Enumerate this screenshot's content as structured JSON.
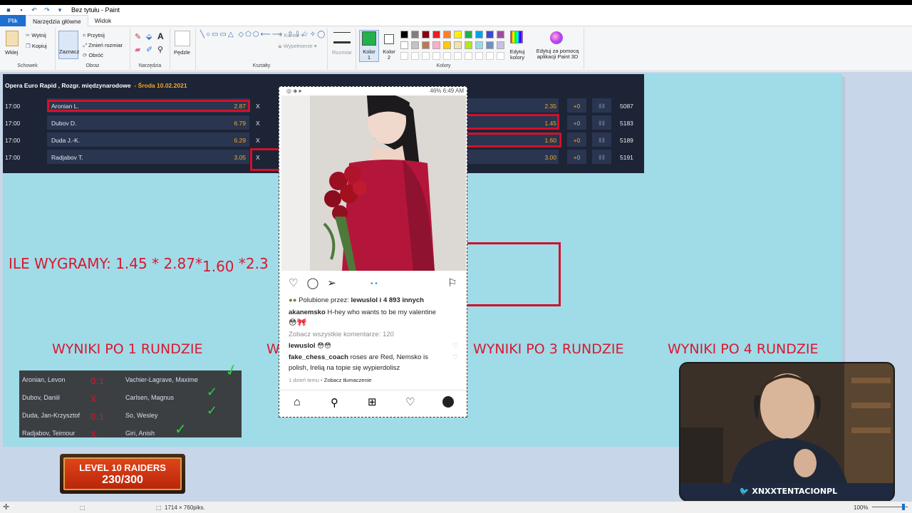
{
  "window": {
    "title": "Bez tytułu - Paint"
  },
  "tabs": [
    {
      "label": "Plik"
    },
    {
      "label": "Narzędzia główne"
    },
    {
      "label": "Widok"
    }
  ],
  "ribbon": {
    "clipboard": {
      "paste": "Wklej",
      "cut": "Wytnij",
      "copy": "Kopiuj",
      "group": "Schowek"
    },
    "image": {
      "select": "Zaznacz",
      "crop": "Przytnij",
      "resize": "Zmień rozmiar",
      "rotate": "Obróć",
      "group": "Obraz"
    },
    "tools": {
      "group": "Narzędzia"
    },
    "brushes": {
      "label": "Pędzle"
    },
    "shapes": {
      "outline": "Kontur",
      "fill": "Wypełnienie",
      "group": "Kształty"
    },
    "size": {
      "label": "Rozmiar"
    },
    "colors": {
      "color1": "Kolor 1",
      "color2": "Kolor 2",
      "edit": "Edytuj kolory",
      "group": "Kolory",
      "active_color": "#22b14c",
      "palette_row1": [
        "#000000",
        "#7f7f7f",
        "#880015",
        "#ed1c24",
        "#ff7f27",
        "#fff200",
        "#22b14c",
        "#00a2e8",
        "#3f48cc",
        "#a349a4"
      ],
      "palette_row2": [
        "#ffffff",
        "#c3c3c3",
        "#b97a57",
        "#ffaec9",
        "#ffc90e",
        "#efe4b0",
        "#b5e61d",
        "#99d9ea",
        "#7092be",
        "#c8bfe7"
      ]
    },
    "paint3d": {
      "label": "Edytuj za pomocą aplikacji Paint 3D"
    }
  },
  "betting": {
    "event": "Opera Euro Rapid , Rozgr. międzynarodowe",
    "date": "- Środa 10.02.2021",
    "rows": [
      {
        "time": "17:00",
        "player": "Aronian L.",
        "odd1": "2.87",
        "x": "X",
        "odd2": "2.35",
        "plus": "+0",
        "num": "5087"
      },
      {
        "time": "17:00",
        "player": "Dubov D.",
        "odd1": "6.79",
        "x": "X",
        "odd2": "1.45",
        "plus": "+0",
        "num": "5183"
      },
      {
        "time": "17:00",
        "player": "Duda J.-K.",
        "odd1": "6.29",
        "x": "X",
        "odd2": "1.60",
        "plus": "+0",
        "num": "5189"
      },
      {
        "time": "17:00",
        "player": "Radjabov T.",
        "odd1": "3.05",
        "x": "X",
        "odd2": "3.00",
        "plus": "+0",
        "num": "5191"
      }
    ]
  },
  "annotations": {
    "calc_prefix": "ILE WYGRAMY: 1.45 * 2.87*",
    "calc_mid": "1.60",
    "calc_end": " *2.3",
    "round1": "WYNIKI PO 1 RUNDZIE",
    "round2_partial": "W",
    "round3": "WYNIKI PO 3 RUNDZIE",
    "round4": "WYNIKI PO 4 RUNDZIE"
  },
  "results": [
    {
      "white": "Aronian, Levon",
      "score": "0:1",
      "black": "Vachier-Lagrave, Maxime"
    },
    {
      "white": "Dubov, Daniil",
      "score": "X",
      "black": "Carlsen, Magnus"
    },
    {
      "white": "Duda, Jan-Krzysztof",
      "score": "0:1",
      "black": "So, Wesley"
    },
    {
      "white": "Radjabov, Teimour",
      "score": "X",
      "black": "Giri, Anish"
    }
  ],
  "instagram": {
    "status_right": "46%  6:49 AM",
    "likes_prefix": "Polubione przez:",
    "likes_user": "lewuslol",
    "likes_suffix": "i 4 893 innych",
    "caption_user": "akanemsko",
    "caption_text": "H-hey who wants to be my valentine",
    "view_comments": "Zobacz wszystkie komentarze: 120",
    "comment1_user": "lewuslol",
    "comment2_user": "fake_chess_coach",
    "comment2_text": "roses are Red, Nemsko is",
    "comment2_text2": "polish, Irelią na topie się wypierdolisz",
    "time_ago": "1 dzień temu",
    "translate": "Zobacz tłumaczenie"
  },
  "stream": {
    "badge_line1": "LEVEL 10 RAIDERS",
    "badge_line2": "230/300",
    "twitter_handle": "XNXXTENTACIONPL"
  },
  "statusbar": {
    "dimensions": "1714 × 760piks.",
    "zoom": "100%"
  }
}
